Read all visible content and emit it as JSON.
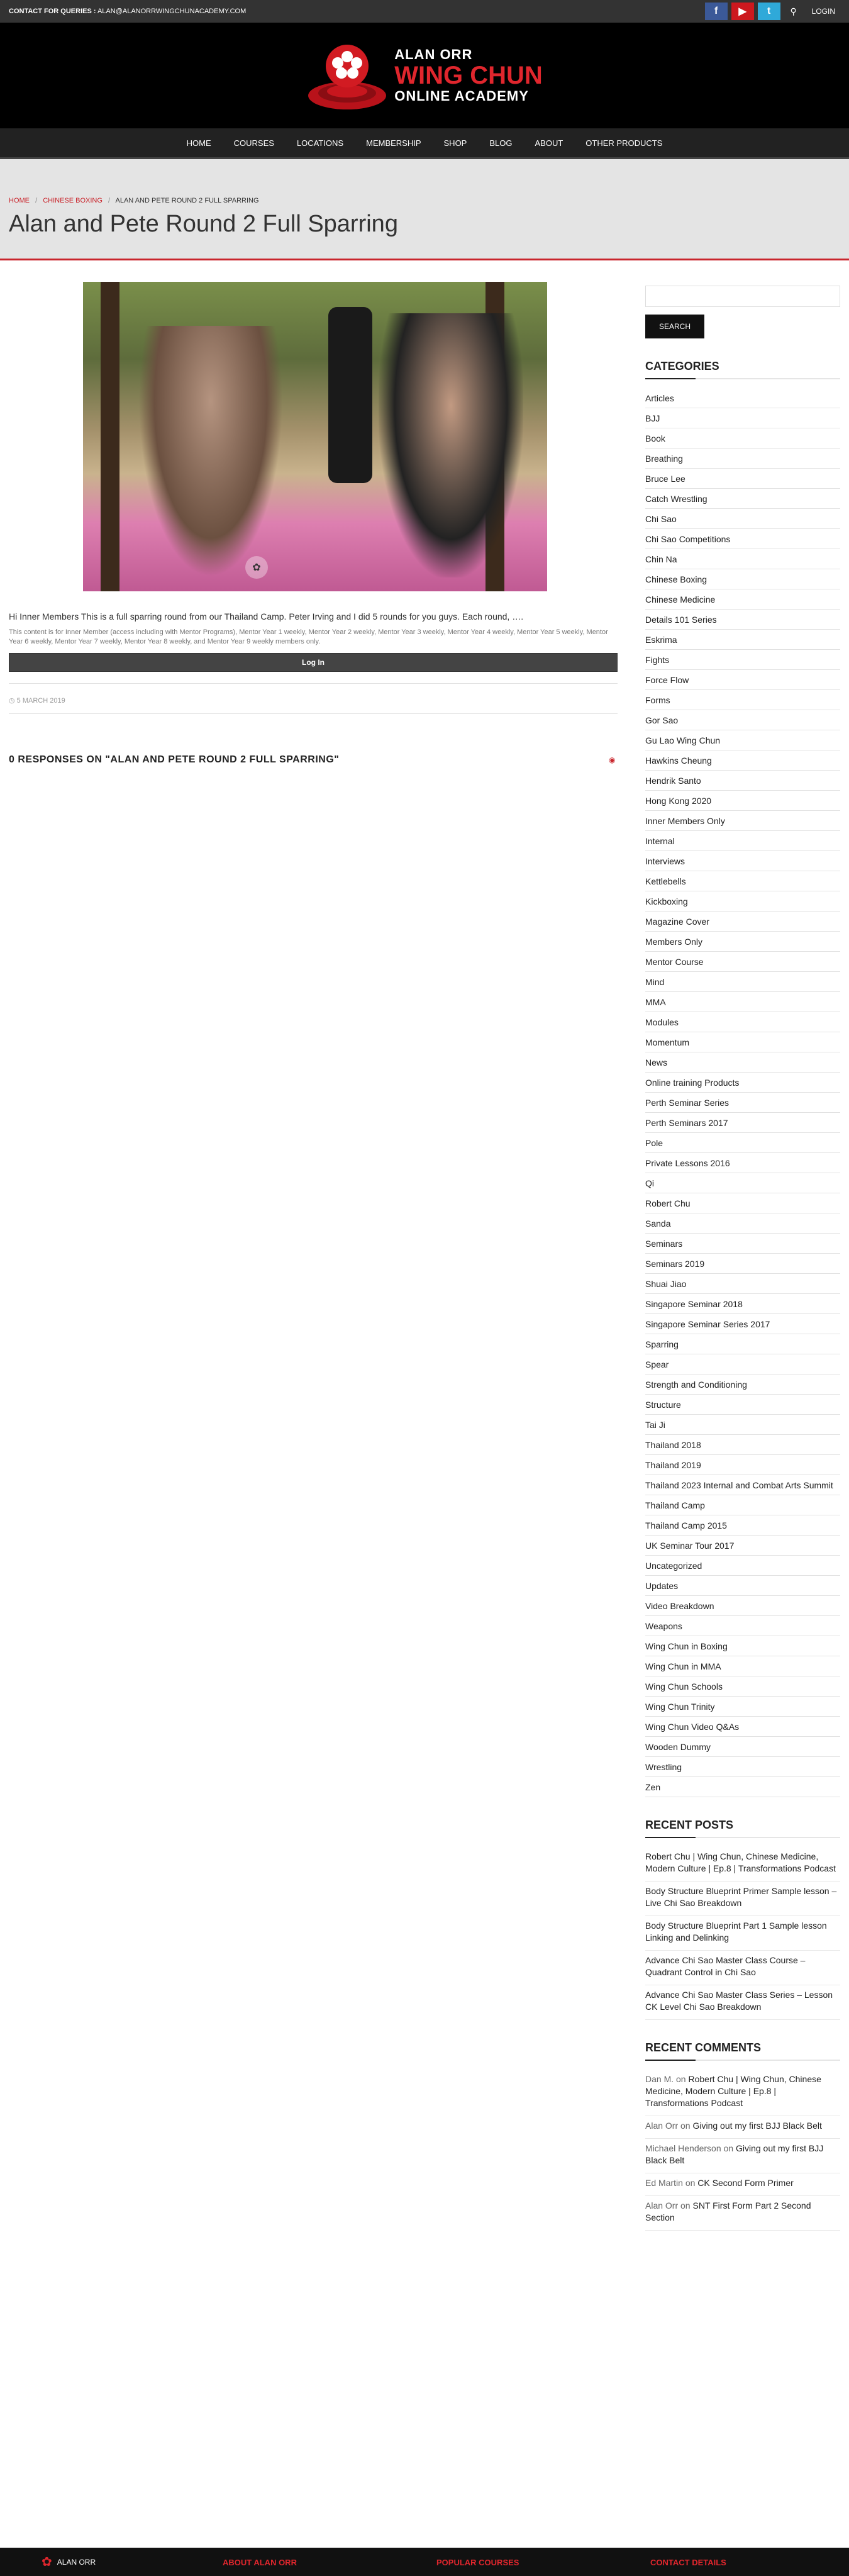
{
  "topbar": {
    "contact_label": "CONTACT FOR QUERIES :",
    "contact_email": "ALAN@ALANORRWINGCHUNACADEMY.COM",
    "social": [
      {
        "icon": "facebook-icon",
        "glyph": "f"
      },
      {
        "icon": "youtube-icon",
        "glyph": "▶"
      },
      {
        "icon": "twitter-icon",
        "glyph": "t"
      }
    ],
    "login": "LOGIN"
  },
  "logo": {
    "line1": "ALAN ORR",
    "line2": "WING CHUN",
    "line3": "ONLINE ACADEMY",
    "brand_red": "#e0262d"
  },
  "nav": [
    "HOME",
    "COURSES",
    "LOCATIONS",
    "MEMBERSHIP",
    "SHOP",
    "BLOG",
    "ABOUT",
    "OTHER PRODUCTS"
  ],
  "breadcrumb": {
    "home": "HOME",
    "category": "CHINESE BOXING",
    "current": "ALAN AND PETE ROUND 2 FULL SPARRING",
    "sep": "/"
  },
  "page_title": "Alan and Pete Round 2 Full Sparring",
  "post": {
    "excerpt": "Hi Inner Members This is a full sparring round from our Thailand Camp. Peter Irving and I did 5 rounds for you guys. Each round, ….",
    "restricted": "This content is for Inner Member (access including with Mentor Programs), Mentor Year 1 weekly, Mentor Year 2 weekly, Mentor Year 3 weekly, Mentor Year 4 weekly, Mentor Year 5 weekly, Mentor Year 6 weekly, Mentor Year 7 weekly, Mentor Year 8 weekly, and Mentor Year 9 weekly members only.",
    "login_button": "Log In",
    "date": "5 MARCH 2019",
    "responses_heading": "0 RESPONSES ON \"ALAN AND PETE ROUND 2 FULL SPARRING\""
  },
  "sidebar": {
    "search_button": "SEARCH",
    "categories_title": "CATEGORIES",
    "categories": [
      "Articles",
      "BJJ",
      "Book",
      "Breathing",
      "Bruce Lee",
      "Catch Wrestling",
      "Chi Sao",
      "Chi Sao Competitions",
      "Chin Na",
      "Chinese Boxing",
      "Chinese Medicine",
      "Details 101 Series",
      "Eskrima",
      "Fights",
      "Force Flow",
      "Forms",
      "Gor Sao",
      "Gu Lao Wing Chun",
      "Hawkins Cheung",
      "Hendrik Santo",
      "Hong Kong 2020",
      "Inner Members Only",
      "Internal",
      "Interviews",
      "Kettlebells",
      "Kickboxing",
      "Magazine Cover",
      "Members Only",
      "Mentor Course",
      "Mind",
      "MMA",
      "Modules",
      "Momentum",
      "News",
      "Online training Products",
      "Perth Seminar Series",
      "Perth Seminars 2017",
      "Pole",
      "Private Lessons 2016",
      "Qi",
      "Robert Chu",
      "Sanda",
      "Seminars",
      "Seminars 2019",
      "Shuai Jiao",
      "Singapore Seminar 2018",
      "Singapore Seminar Series 2017",
      "Sparring",
      "Spear",
      "Strength and Conditioning",
      "Structure",
      "Tai Ji",
      "Thailand 2018",
      "Thailand 2019",
      "Thailand 2023 Internal and Combat Arts Summit",
      "Thailand Camp",
      "Thailand Camp 2015",
      "UK Seminar Tour 2017",
      "Uncategorized",
      "Updates",
      "Video Breakdown",
      "Weapons",
      "Wing Chun in Boxing",
      "Wing Chun in MMA",
      "Wing Chun Schools",
      "Wing Chun Trinity",
      "Wing Chun Video Q&As",
      "Wooden Dummy",
      "Wrestling",
      "Zen"
    ],
    "recent_posts_title": "RECENT POSTS",
    "recent_posts": [
      "Robert Chu | Wing Chun, Chinese Medicine, Modern Culture | Ep.8 | Transformations Podcast",
      "Body Structure Blueprint Primer Sample lesson – Live Chi Sao Breakdown",
      "Body Structure Blueprint Part 1 Sample lesson Linking and Delinking",
      "Advance Chi Sao Master Class Course – Quadrant Control in Chi Sao",
      "Advance Chi Sao Master Class Series – Lesson CK Level Chi Sao Breakdown"
    ],
    "recent_comments_title": "RECENT COMMENTS",
    "recent_comments": [
      {
        "author": "Dan M.",
        "on": "on",
        "post": "Robert Chu | Wing Chun, Chinese Medicine, Modern Culture | Ep.8 | Transformations Podcast"
      },
      {
        "author": "Alan Orr",
        "on": "on",
        "post": "Giving out my first BJJ Black Belt"
      },
      {
        "author": "Michael Henderson",
        "on": "on",
        "post": "Giving out my first BJJ Black Belt"
      },
      {
        "author": "Ed Martin",
        "on": "on",
        "post": "CK Second Form Primer"
      },
      {
        "author": "Alan Orr",
        "on": "on",
        "post": "SNT First Form Part 2 Second Section"
      }
    ]
  },
  "footer": {
    "logo_text": "ALAN ORR",
    "headings": [
      "ABOUT ALAN ORR",
      "POPULAR COURSES",
      "CONTACT DETAILS"
    ]
  }
}
